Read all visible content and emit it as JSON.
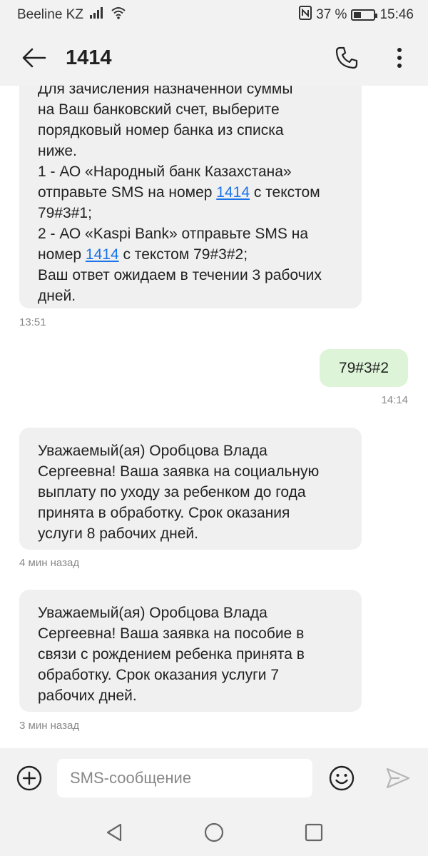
{
  "status_bar": {
    "carrier": "Beeline KZ",
    "battery_percent": "37 %",
    "battery_level": 0.37,
    "time": "15:46",
    "icons": [
      "signal-icon",
      "wifi-icon",
      "nfc-icon",
      "battery-icon"
    ]
  },
  "header": {
    "title": "1414",
    "icons": [
      "back-arrow-icon",
      "phone-icon",
      "more-vert-icon"
    ]
  },
  "messages": {
    "m1": {
      "l0": "Для зачисления назначенной суммы",
      "l1": "на Ваш банковский счет, выберите",
      "l2": "порядковый номер банка из списка",
      "l3": "ниже.",
      "l4": "1 - АО «Народный банк Казахстана»",
      "l5_a": "отправьте SMS на номер ",
      "l5_link": "1414",
      "l5_b": " с текстом",
      "l6": "79#3#1;",
      "l7": "2 - АО «Kaspi Bank» отправьте SMS на",
      "l8_a": "номер ",
      "l8_link": "1414",
      "l8_b": " с текстом 79#3#2;",
      "l9": "Ваш ответ ожидаем в течении 3 рабочих",
      "l10": "дней.",
      "time": "13:51"
    },
    "m2": {
      "text": "79#3#2",
      "time": "14:14"
    },
    "m3": {
      "text": "Уважаемый(ая) Оробцова Влада\nСергеевна! Ваша заявка на социальную\nвыплату по уходу за ребенком до года\nпринята в обработку. Срок оказания\nуслуги 8 рабочих дней.",
      "time": "4 мин назад"
    },
    "m4": {
      "text": "Уважаемый(ая) Оробцова Влада\nСергеевна! Ваша заявка на пособие в\nсвязи с рождением ребенка принята в\nобработку. Срок оказания услуги 7\nрабочих дней.",
      "time": "3 мин назад"
    }
  },
  "composer": {
    "placeholder": "SMS-сообщение",
    "icons": [
      "add-circle-icon",
      "emoji-icon",
      "send-icon"
    ]
  },
  "nav": {
    "icons": [
      "nav-back-icon",
      "nav-home-icon",
      "nav-recents-icon"
    ]
  },
  "colors": {
    "bar_bg": "#f2f2f2",
    "incoming_bubble": "#f0f0f0",
    "outgoing_bubble": "#ddf4d8",
    "link": "#1a73e8"
  }
}
